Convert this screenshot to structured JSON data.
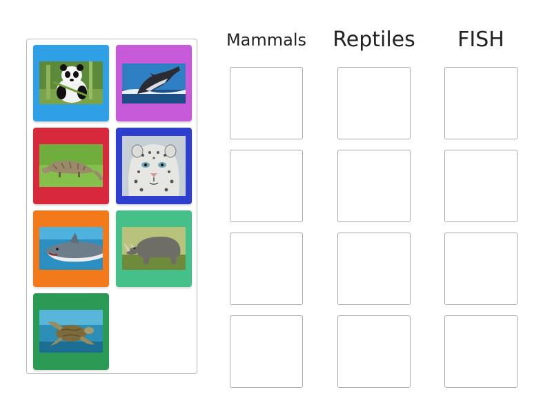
{
  "columns": [
    {
      "label": "Mammals"
    },
    {
      "label": "Reptiles"
    },
    {
      "label": "FISH"
    }
  ],
  "cards": [
    {
      "icon": "panda-photo",
      "color": "#2f9fe6"
    },
    {
      "icon": "whale-photo",
      "color": "#c65ad9"
    },
    {
      "icon": "pangolin-photo",
      "color": "#d8283b"
    },
    {
      "icon": "snow-leopard-photo",
      "color": "#2e3fcf"
    },
    {
      "icon": "shark-photo",
      "color": "#f27a1a"
    },
    {
      "icon": "rhino-photo",
      "color": "#45c089"
    },
    {
      "icon": "sea-turtle-photo",
      "color": "#2a9a55"
    }
  ],
  "rows_per_column": 4
}
